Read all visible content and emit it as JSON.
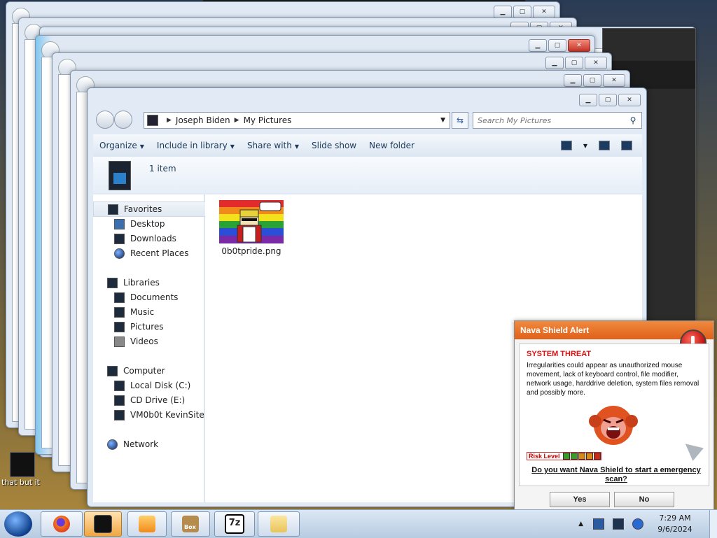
{
  "desktop": {
    "icon_label": "that but it"
  },
  "explorer": {
    "breadcrumb": [
      "Joseph Biden",
      "My Pictures"
    ],
    "search_placeholder": "Search My Pictures",
    "toolbar": {
      "organize": "Organize",
      "include_in_library": "Include in library",
      "share_with": "Share with",
      "slide_show": "Slide show",
      "new_folder": "New folder"
    },
    "item_count": "1 item",
    "nav": {
      "favorites": "Favorites",
      "desktop": "Desktop",
      "downloads": "Downloads",
      "recent_places": "Recent Places",
      "libraries": "Libraries",
      "documents": "Documents",
      "music": "Music",
      "pictures": "Pictures",
      "videos": "Videos",
      "computer": "Computer",
      "local_disk": "Local Disk (C:)",
      "cd_drive": "CD Drive (E:)",
      "network_share": "VM0b0t KevinSite",
      "network": "Network"
    },
    "files": [
      {
        "name": "0b0tpride.png",
        "icon": "image-thumbnail"
      }
    ]
  },
  "alert": {
    "title": "Nava Shield Alert",
    "heading": "SYSTEM THREAT",
    "message": "Irregularities could appear as unauthorized mouse movement, lack of keyboard control, file modifier, network usage, harddrive deletion, system files removal and possibly more.",
    "risk_label": "Risk Level",
    "question": "Do you want Nava Shield to start a emergency scan?",
    "yes": "Yes",
    "no": "No",
    "risk_colors": [
      "#3a9a2a",
      "#3a9a2a",
      "#d48a1a",
      "#d48a1a",
      "#c82a1a"
    ]
  },
  "taskbar": {
    "apps": [
      "firefox-icon",
      "box-icon",
      "media-player-icon",
      "hamster-box-icon",
      "7zip-icon",
      "folder-icon"
    ],
    "sevenzip_label": "7z",
    "box_label": "Box",
    "time": "7:29 AM",
    "date": "9/6/2024"
  }
}
